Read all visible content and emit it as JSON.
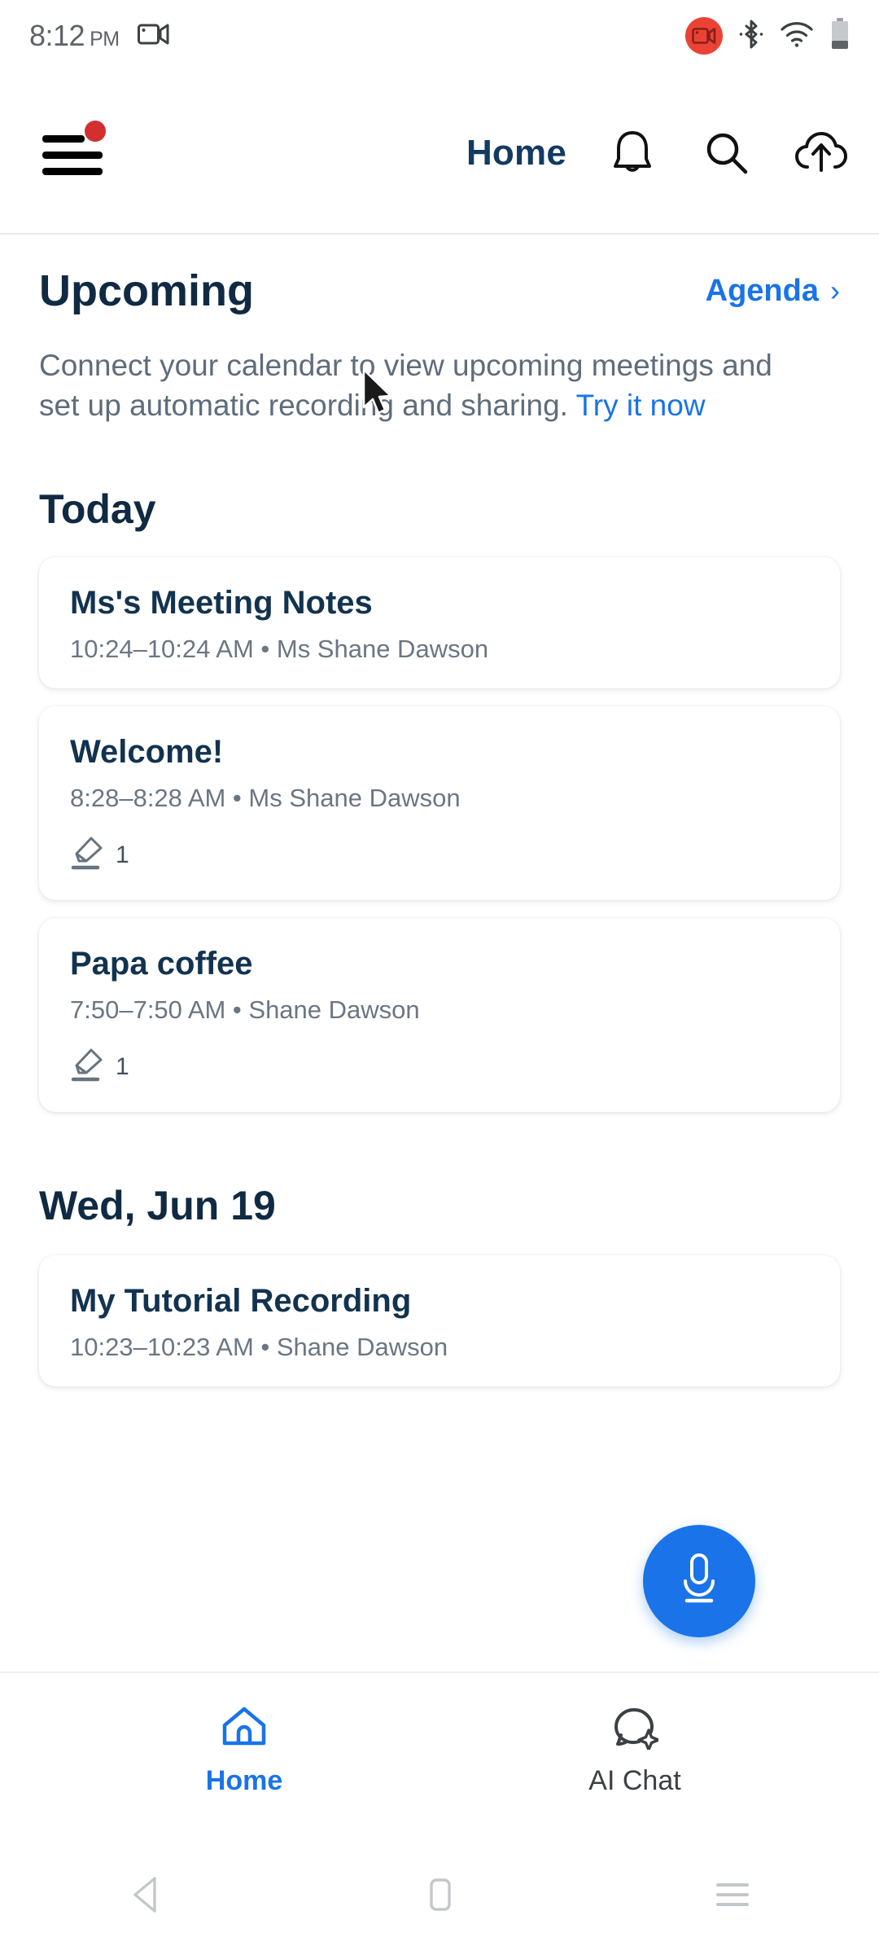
{
  "status_bar": {
    "time": "8:12",
    "ampm": "PM",
    "screen_record_icon": "camcorder-icon",
    "right_icons": [
      "screen-record-badge-icon",
      "bluetooth-icon",
      "wifi-icon",
      "battery-icon"
    ]
  },
  "app_bar": {
    "menu_icon": "hamburger-menu-icon",
    "menu_badge": true,
    "title": "Home",
    "actions": [
      {
        "name": "notifications-icon",
        "label": "Notifications"
      },
      {
        "name": "search-icon",
        "label": "Search"
      },
      {
        "name": "cloud-upload-icon",
        "label": "Upload"
      }
    ]
  },
  "upcoming": {
    "heading": "Upcoming",
    "agenda_label": "Agenda",
    "agenda_chevron": "›",
    "description_pre": "Connect your calendar to view upcoming meetings and set up automatic recording and sharing. ",
    "description_link": "Try it now"
  },
  "sections": [
    {
      "heading": "Today",
      "cards": [
        {
          "title": "Ms's Meeting Notes",
          "subtitle": "10:24–10:24 AM  •  Ms Shane Dawson",
          "highlight_count": null
        },
        {
          "title": "Welcome!",
          "subtitle": "8:28–8:28 AM  •  Ms Shane Dawson",
          "highlight_count": "1"
        },
        {
          "title": "Papa coffee",
          "subtitle": "7:50–7:50 AM  •  Shane Dawson",
          "highlight_count": "1"
        }
      ]
    },
    {
      "heading": "Wed, Jun 19",
      "cards": [
        {
          "title": "My Tutorial Recording",
          "subtitle": "10:23–10:23 AM  •  Shane Dawson",
          "highlight_count": null
        }
      ]
    }
  ],
  "fab": {
    "icon": "microphone-icon",
    "color": "#1a73e8"
  },
  "bottom_nav": {
    "items": [
      {
        "label": "Home",
        "icon": "home-icon",
        "active": true
      },
      {
        "label": "AI Chat",
        "icon": "ai-chat-bubble-icon",
        "active": false
      }
    ]
  },
  "android_nav": {
    "back": "back-triangle-icon",
    "home": "home-square-icon",
    "recents": "recents-lines-icon"
  },
  "colors": {
    "accent_blue": "#1a73e8",
    "title_navy": "#102a43",
    "body_gray": "#5f6c7b",
    "badge_red": "#d32f2f"
  }
}
